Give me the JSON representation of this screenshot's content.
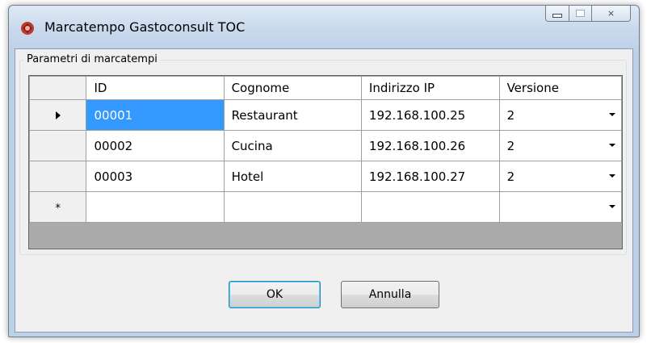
{
  "window": {
    "title": "Marcatempo Gastoconsult TOC",
    "icon": "app-logo-icon"
  },
  "caption_buttons": {
    "minimize_icon": "minimize-icon",
    "maximize_icon": "maximize-icon",
    "close_glyph": "⨯"
  },
  "group": {
    "label": "Parametri di marcatempi"
  },
  "grid": {
    "columns": [
      "ID",
      "Cognome",
      "Indirizzo IP",
      "Versione"
    ],
    "rows": [
      {
        "id": "00001",
        "cognome": "Restaurant",
        "ip": "192.168.100.25",
        "versione": "2"
      },
      {
        "id": "00002",
        "cognome": "Cucina",
        "ip": "192.168.100.26",
        "versione": "2"
      },
      {
        "id": "00003",
        "cognome": "Hotel",
        "ip": "192.168.100.27",
        "versione": "2"
      }
    ],
    "new_row_marker": "*",
    "current_row_marker": "▶",
    "selected_color": "#3399ff"
  },
  "buttons": {
    "ok": "OK",
    "cancel": "Annulla"
  }
}
